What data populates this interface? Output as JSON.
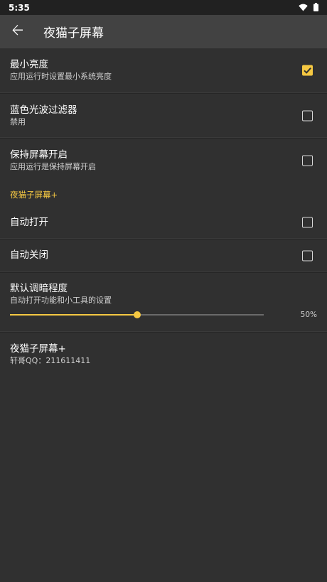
{
  "status_bar": {
    "time": "5:35",
    "icons": [
      "wifi-icon",
      "battery-icon"
    ]
  },
  "app_bar": {
    "title": "夜猫子屏幕",
    "back_icon": "arrow-left-icon"
  },
  "preferences": [
    {
      "title": "最小亮度",
      "summary": "应用运行时设置最小系统亮度",
      "checked": true
    },
    {
      "title": "蓝色光波过滤器",
      "summary": "禁用",
      "checked": false
    },
    {
      "title": "保持屏幕开启",
      "summary": "应用运行是保持屏幕开启",
      "checked": false
    }
  ],
  "category": {
    "title": "夜猫子屏幕+"
  },
  "plus_preferences": [
    {
      "title": "自动打开",
      "checked": false
    },
    {
      "title": "自动关闭",
      "checked": false
    }
  ],
  "dim_level": {
    "title": "默认调暗程度",
    "summary": "自动打开功能和小工具的设置",
    "value_percent": 50,
    "value_label": "50%"
  },
  "about": {
    "title": "夜猫子屏幕+",
    "summary": "轩哥QQ：211611411"
  },
  "colors": {
    "accent": "#f5c842",
    "background": "#303030",
    "app_bar": "#424242",
    "status_bar": "#212121"
  }
}
